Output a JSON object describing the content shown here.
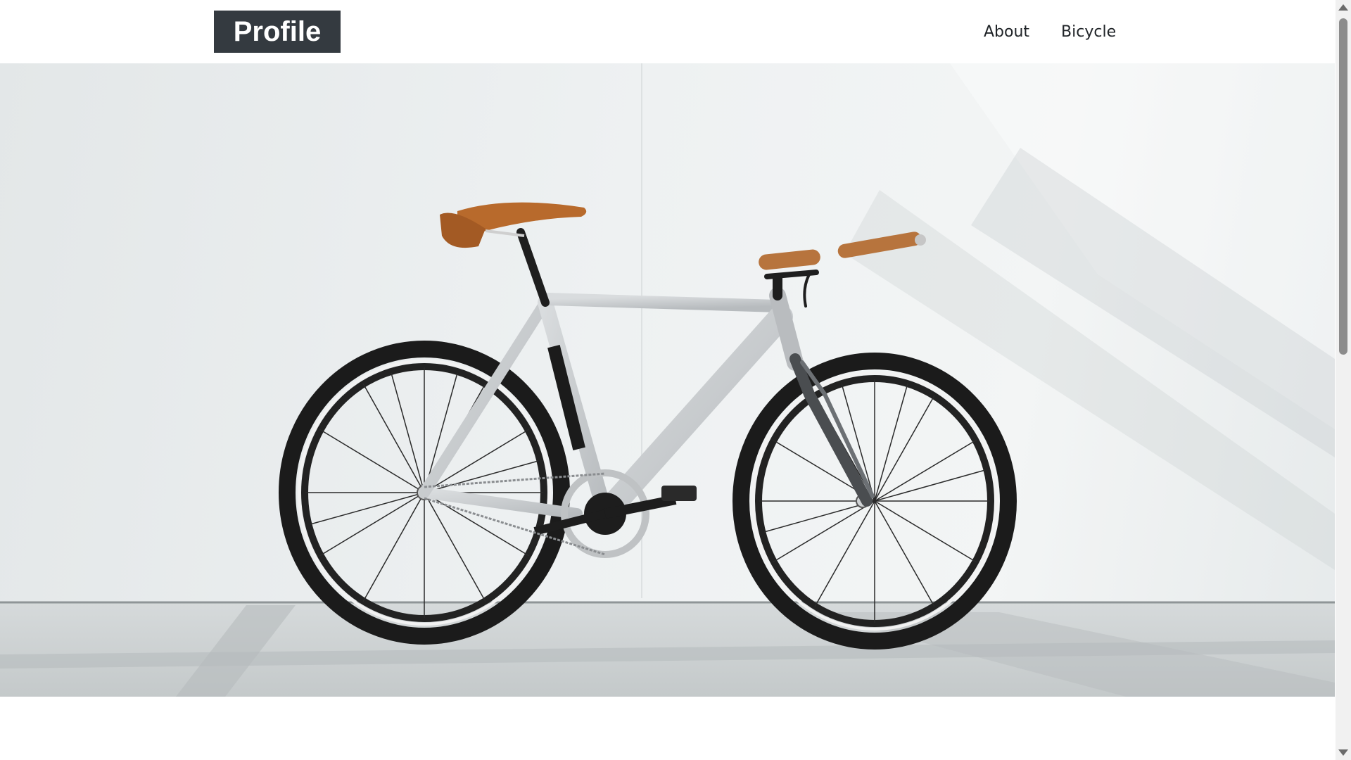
{
  "header": {
    "brand": "Profile",
    "nav": [
      {
        "label": "About"
      },
      {
        "label": "Bicycle"
      }
    ]
  },
  "hero": {
    "image": "bicycle-photo"
  },
  "colors": {
    "brand_bg": "#343a40",
    "brand_text": "#ffffff",
    "nav_text": "#212529",
    "wall": "#eef1f2",
    "floor": "#c9cecf",
    "frame": "#c9ccce",
    "tire": "#1c1c1c",
    "leather": "#b56a2e"
  }
}
